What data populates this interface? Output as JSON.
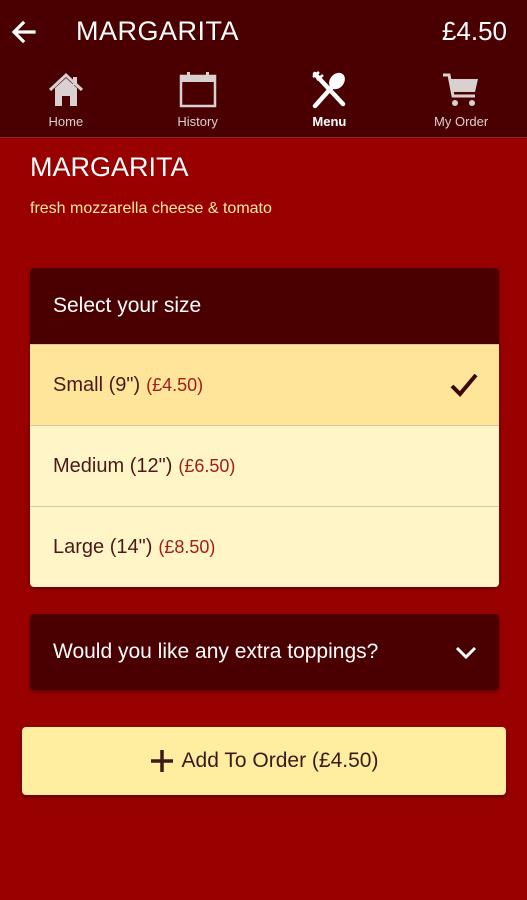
{
  "header": {
    "title": "MARGARITA",
    "price": "£4.50",
    "back_icon": "arrow-left-icon"
  },
  "nav": {
    "tabs": [
      {
        "label": "Home",
        "icon": "home-icon"
      },
      {
        "label": "History",
        "icon": "calendar-icon"
      },
      {
        "label": "Menu",
        "icon": "fork-knife-icon",
        "active": true
      },
      {
        "label": "My Order",
        "icon": "cart-icon"
      }
    ]
  },
  "item": {
    "name": "MARGARITA",
    "description": "fresh mozzarella cheese & tomato"
  },
  "size_section": {
    "heading": "Select your size",
    "options": [
      {
        "name": "Small (9\")",
        "price": "(£4.50)",
        "selected": true
      },
      {
        "name": "Medium (12\")",
        "price": "(£6.50)",
        "selected": false
      },
      {
        "name": "Large (14\")",
        "price": "(£8.50)",
        "selected": false
      }
    ]
  },
  "toppings": {
    "label": "Would you like any extra toppings?"
  },
  "add_button": {
    "label": "Add To Order (£4.50)"
  },
  "colors": {
    "background": "#990000",
    "header": "#4a0000",
    "selected_option": "#ffe59a",
    "option": "#fff5c6",
    "accent_text": "#ffe9a0"
  }
}
